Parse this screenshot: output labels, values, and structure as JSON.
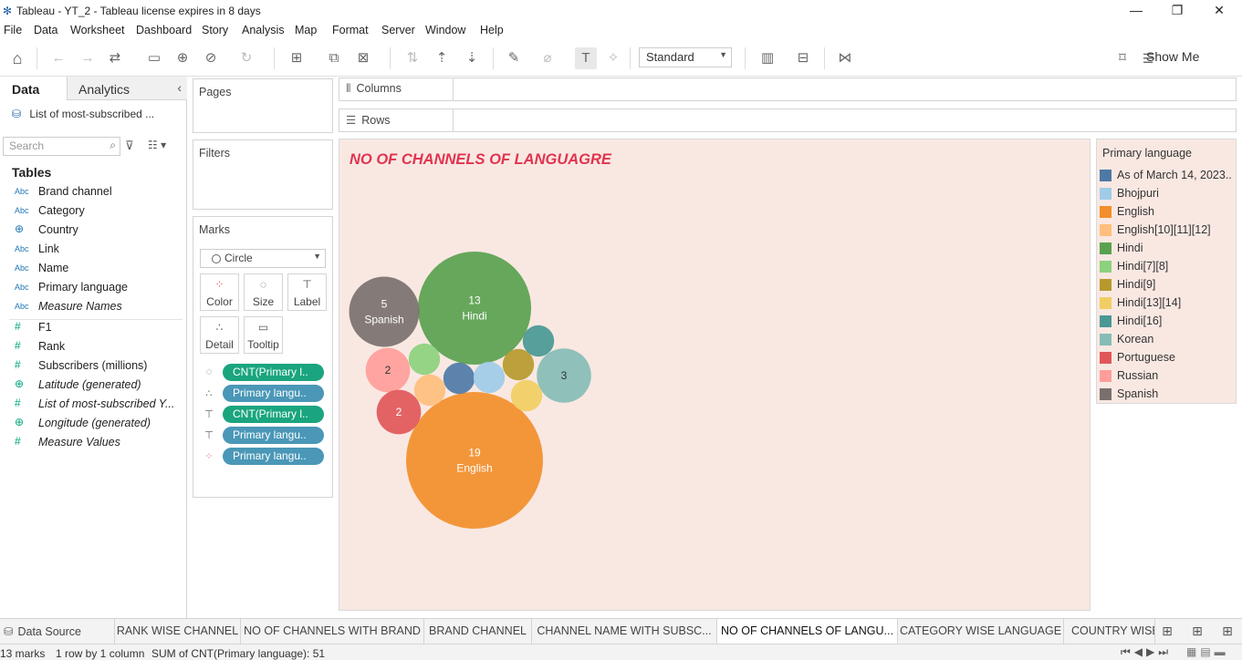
{
  "window": {
    "title": "Tableau - YT_2 - Tableau license expires in 8 days",
    "minimize": "—",
    "maximize": "❐",
    "close": "✕"
  },
  "menu": [
    "File",
    "Data",
    "Worksheet",
    "Dashboard",
    "Story",
    "Analysis",
    "Map",
    "Format",
    "Server",
    "Window",
    "Help"
  ],
  "toolbar": {
    "fit_select": "Standard",
    "show_me": "Show Me"
  },
  "data_pane": {
    "tab_data": "Data",
    "tab_analytics": "Analytics",
    "datasource": "List of most-subscribed ...",
    "search_placeholder": "Search",
    "tables_heading": "Tables",
    "dimensions": [
      {
        "type": "Abc",
        "name": "Brand channel"
      },
      {
        "type": "Abc",
        "name": "Category"
      },
      {
        "type": "globe",
        "name": "Country"
      },
      {
        "type": "Abc",
        "name": "Link"
      },
      {
        "type": "Abc",
        "name": "Name"
      },
      {
        "type": "Abc",
        "name": "Primary language"
      },
      {
        "type": "Abc",
        "name": "Measure Names"
      }
    ],
    "measures": [
      {
        "type": "#",
        "name": "F1"
      },
      {
        "type": "#",
        "name": "Rank"
      },
      {
        "type": "#",
        "name": "Subscribers (millions)"
      },
      {
        "type": "globe",
        "name": "Latitude (generated)"
      },
      {
        "type": "#",
        "name": "List of most-subscribed Y..."
      },
      {
        "type": "globe",
        "name": "Longitude (generated)"
      },
      {
        "type": "#",
        "name": "Measure Values"
      }
    ]
  },
  "cards": {
    "pages": "Pages",
    "filters": "Filters",
    "marks": "Marks",
    "columns": "Columns",
    "rows": "Rows"
  },
  "marks": {
    "type": "Circle",
    "buttons": [
      "Color",
      "Size",
      "Label",
      "Detail",
      "Tooltip"
    ],
    "pills": [
      {
        "icon": "size-icon",
        "label": "CNT(Primary l..",
        "kind": "measure"
      },
      {
        "icon": "detail-icon",
        "label": "Primary langu..",
        "kind": "dimension"
      },
      {
        "icon": "label-icon",
        "label": "CNT(Primary l..",
        "kind": "measure"
      },
      {
        "icon": "label-icon",
        "label": "Primary langu..",
        "kind": "dimension"
      },
      {
        "icon": "color-icon",
        "label": "Primary langu..",
        "kind": "dimension"
      }
    ]
  },
  "viz": {
    "title": "NO OF CHANNELS OF LANGUAGRE"
  },
  "chart_data": {
    "type": "bubble",
    "title": "NO OF CHANNELS OF LANGUAGRE",
    "series": [
      {
        "name": "English",
        "value": 19,
        "color": "#f28e2b",
        "label": "19\nEnglish"
      },
      {
        "name": "Hindi",
        "value": 13,
        "color": "#59a14f",
        "label": "13\nHindi"
      },
      {
        "name": "Spanish",
        "value": 5,
        "color": "#79706e",
        "label": "5\nSpanish"
      },
      {
        "name": "Korean",
        "value": 3,
        "color": "#86bcb6",
        "label": "3"
      },
      {
        "name": "Russian",
        "value": 2,
        "color": "#ff9d9a",
        "label": "2"
      },
      {
        "name": "Portuguese",
        "value": 2,
        "color": "#e15759",
        "label": "2"
      },
      {
        "name": "Hindi[16]",
        "value": 1,
        "color": "#499894",
        "label": ""
      },
      {
        "name": "Hindi[7][8]",
        "value": 1,
        "color": "#8cd17d",
        "label": ""
      },
      {
        "name": "As of March 14, 2023..",
        "value": 1,
        "color": "#4e79a7",
        "label": ""
      },
      {
        "name": "Bhojpuri",
        "value": 1,
        "color": "#a0cbe8",
        "label": ""
      },
      {
        "name": "Hindi[9]",
        "value": 1,
        "color": "#b6992d",
        "label": ""
      },
      {
        "name": "English[10][11][12]",
        "value": 1,
        "color": "#ffbe7d",
        "label": ""
      },
      {
        "name": "Hindi[13][14]",
        "value": 1,
        "color": "#f1ce63",
        "label": ""
      }
    ]
  },
  "legend": {
    "title": "Primary language",
    "items": [
      {
        "label": "As of March 14, 2023..",
        "color": "#4e79a7"
      },
      {
        "label": "Bhojpuri",
        "color": "#a0cbe8"
      },
      {
        "label": "English",
        "color": "#f28e2b"
      },
      {
        "label": "English[10][11][12]",
        "color": "#ffbe7d"
      },
      {
        "label": "Hindi",
        "color": "#59a14f"
      },
      {
        "label": "Hindi[7][8]",
        "color": "#8cd17d"
      },
      {
        "label": "Hindi[9]",
        "color": "#b6992d"
      },
      {
        "label": "Hindi[13][14]",
        "color": "#f1ce63"
      },
      {
        "label": "Hindi[16]",
        "color": "#499894"
      },
      {
        "label": "Korean",
        "color": "#86bcb6"
      },
      {
        "label": "Portuguese",
        "color": "#e15759"
      },
      {
        "label": "Russian",
        "color": "#ff9d9a"
      },
      {
        "label": "Spanish",
        "color": "#79706e"
      }
    ]
  },
  "sheet_tabs": {
    "data_source": "Data Source",
    "tabs": [
      {
        "label": "RANK WISE CHANNEL",
        "active": false
      },
      {
        "label": "NO OF CHANNELS WITH BRAND",
        "active": false
      },
      {
        "label": "BRAND CHANNEL",
        "active": false
      },
      {
        "label": "CHANNEL NAME WITH SUBSC...",
        "active": false
      },
      {
        "label": "NO OF CHANNELS OF LANGU...",
        "active": true
      },
      {
        "label": "CATEGORY WISE LANGUAGE",
        "active": false
      },
      {
        "label": "COUNTRY WISE",
        "active": false
      }
    ]
  },
  "status": {
    "marks": "13 marks",
    "layout": "1 row by 1 column",
    "sum": "SUM of CNT(Primary language): 51"
  }
}
